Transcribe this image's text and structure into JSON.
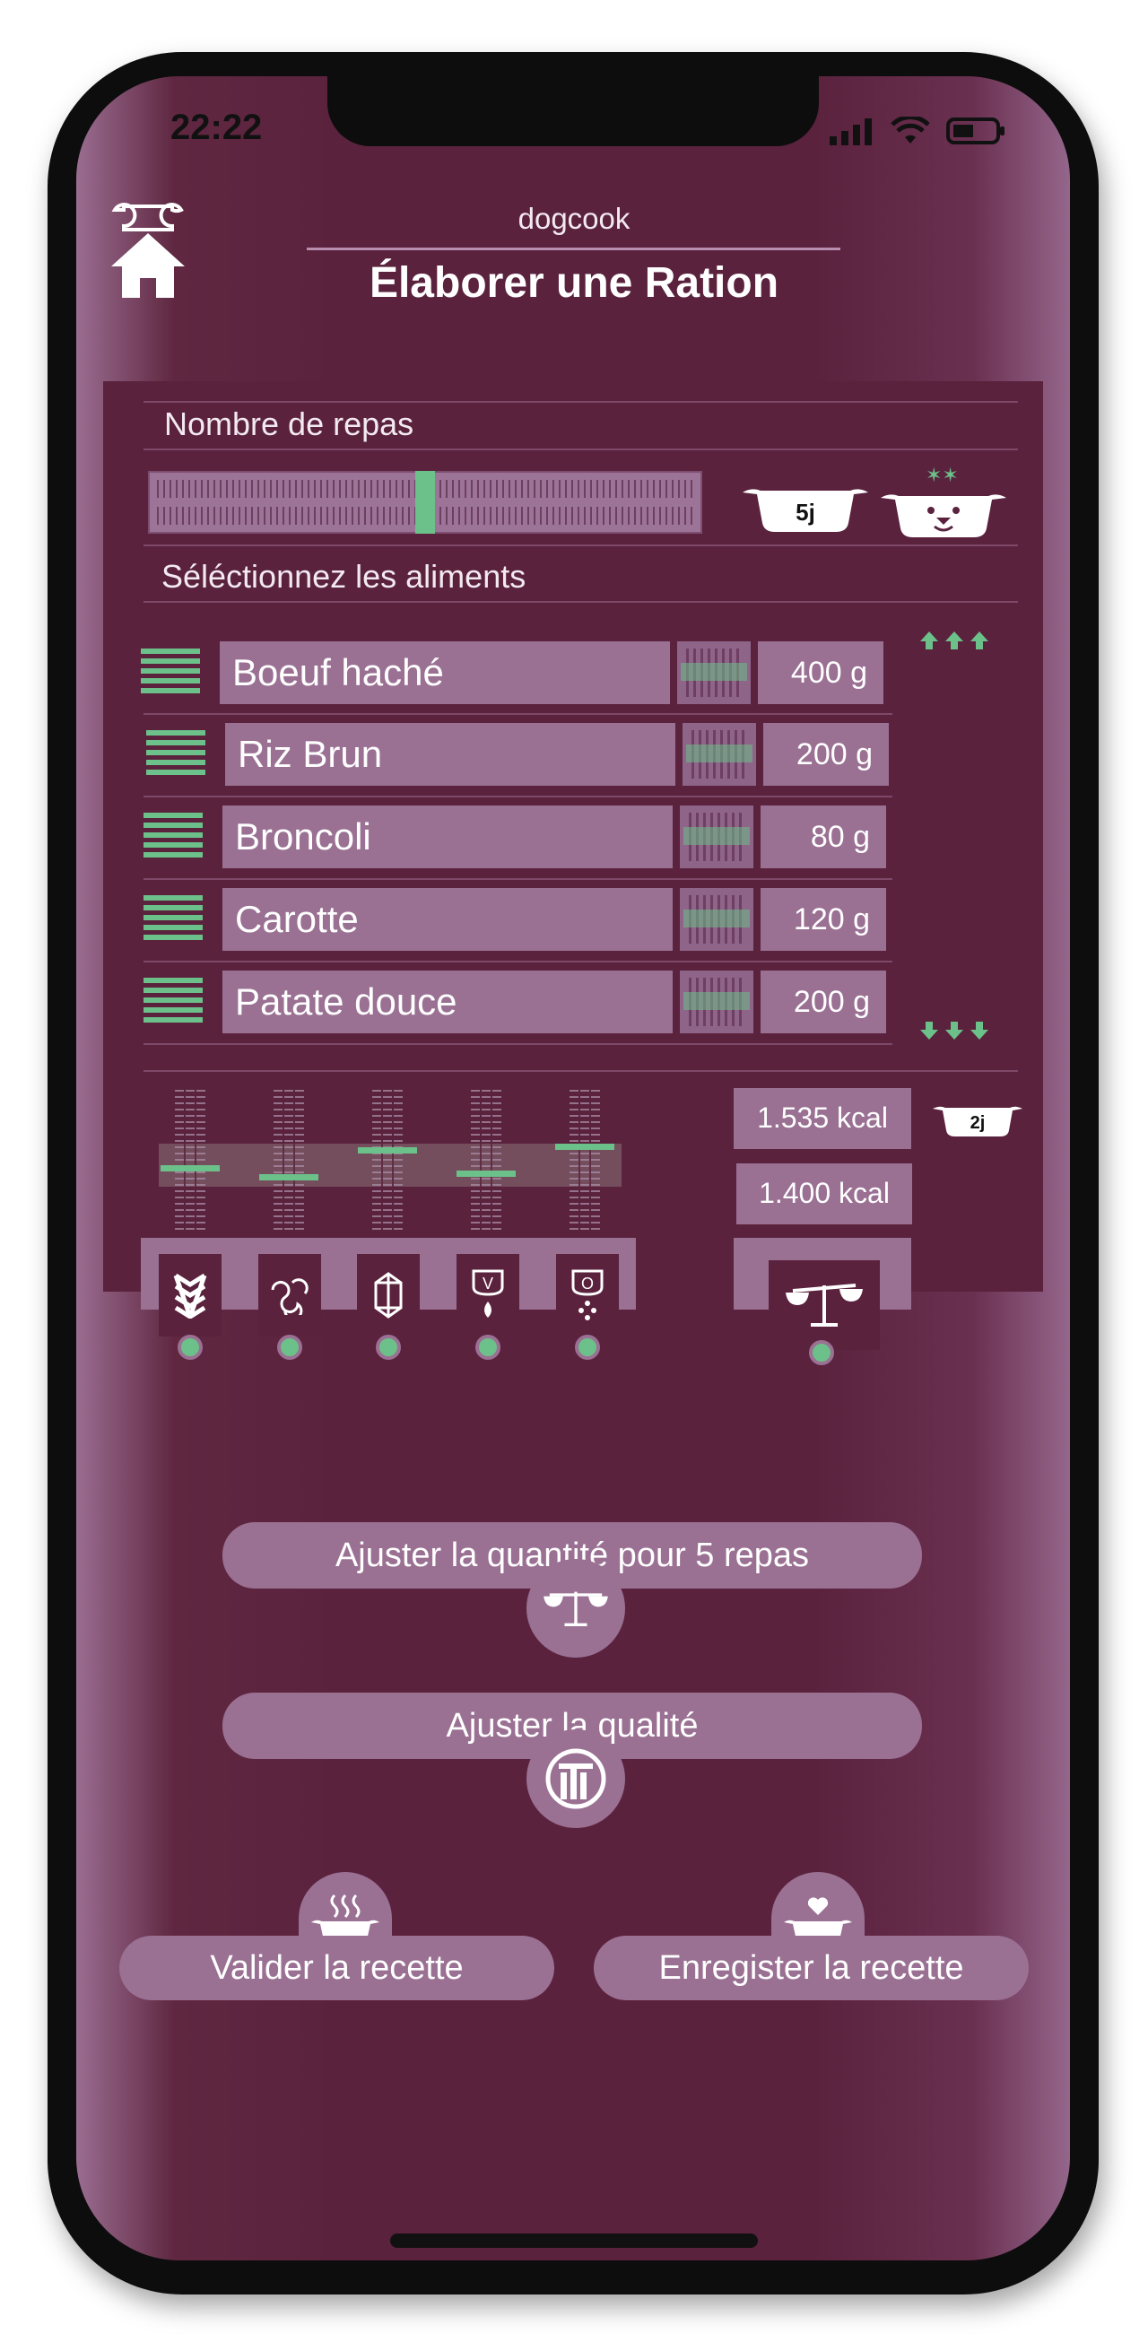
{
  "status_bar": {
    "time": "22:22"
  },
  "header": {
    "app_name": "dogcook",
    "title": "Élaborer une Ration"
  },
  "meals": {
    "label": "Nombre de repas",
    "slider_position": 0.5,
    "badge": "5j"
  },
  "foods": {
    "label": "Séléctionnez les aliments",
    "items": [
      {
        "name": "Boeuf haché",
        "qty": "400 g"
      },
      {
        "name": "Riz Brun",
        "qty": "200 g"
      },
      {
        "name": "Broncoli",
        "qty": "80 g"
      },
      {
        "name": "Carotte",
        "qty": "120 g"
      },
      {
        "name": "Patate douce",
        "qty": "200 g"
      }
    ]
  },
  "nutrition": {
    "kcal_current": "1.535 kcal",
    "kcal_target": "1.400 kcal",
    "badge": "2j",
    "categories": [
      "fibers-icon",
      "proteins-icon",
      "minerals-icon",
      "vitamins-icon",
      "oils-icon"
    ]
  },
  "actions": {
    "adjust_quantity": "Ajuster la quantité pour 5 repas",
    "adjust_quality": "Ajuster la qualité",
    "validate": "Valider la recette",
    "save": "Enregister la recette"
  },
  "colors": {
    "background": "#5a223d",
    "panel_item": "#9a7093",
    "accent_green": "#6cc089",
    "text": "#ffffff"
  }
}
